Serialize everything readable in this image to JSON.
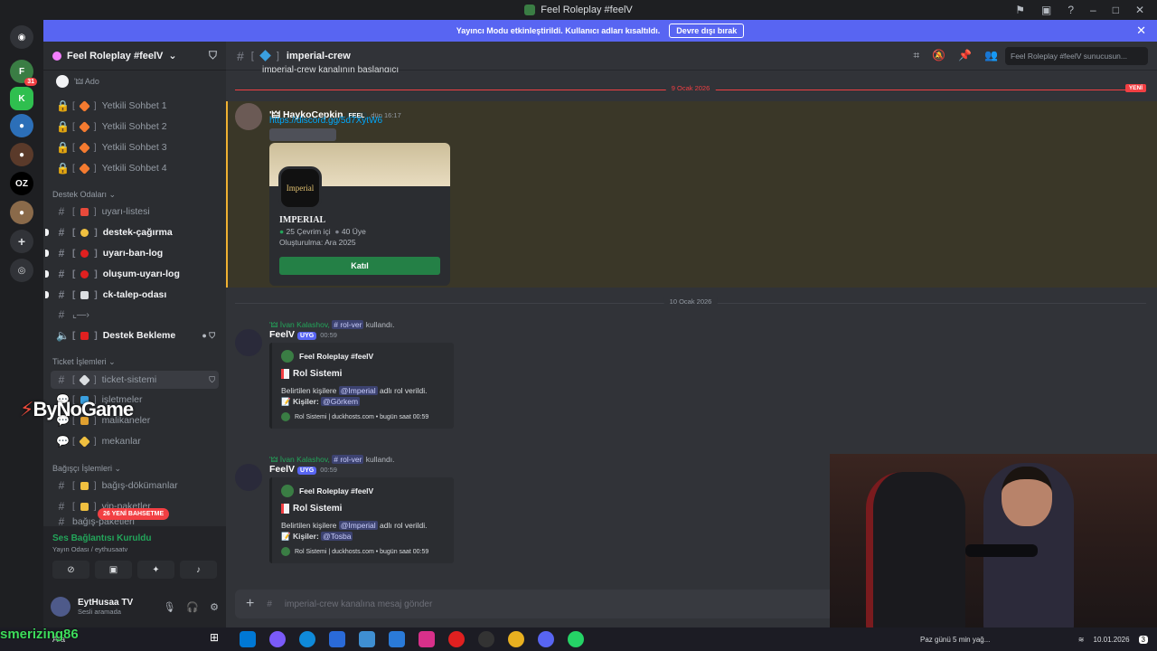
{
  "window": {
    "title": "Feel Roleplay #feelV"
  },
  "banner": {
    "text": "Yayıncı Modu etkinleştirildi. Kullanıcı adları kısaltıldı.",
    "button": "Devre dışı bırak"
  },
  "servers": {
    "dm_badge": "31"
  },
  "guild": {
    "name": "Feel Roleplay #feelV"
  },
  "sidebar": {
    "top_user": "'🜲 Ado",
    "locked_channels": [
      "Yetkili Sohbet 1",
      "Yetkili Sohbet 2",
      "Yetkili Sohbet 3",
      "Yetkili Sohbet 4"
    ],
    "cat_destek": "Destek Odaları ⌄",
    "destek_channels": [
      "uyarı-listesi",
      "destek-çağırma",
      "uyarı-ban-log",
      "oluşum-uyarı-log",
      "ck-talep-odası",
      "⌞—›"
    ],
    "voice_channel": "Destek Bekleme",
    "cat_ticket": "Ticket İşlemleri ⌄",
    "ticket_channels": [
      "ticket-sistemi",
      "işletmeler",
      "malikaneler",
      "mekanlar"
    ],
    "cat_bagis": "Bağışçı İşlemleri ⌄",
    "bagis_channels": [
      "bağış-dökümanlar",
      "vip-paketler",
      "bağış-paketleri"
    ],
    "new_mentions": "26 YENİ BAHSETME"
  },
  "voice": {
    "status": "Ses Bağlantısı Kuruldu",
    "detail": "Yayın Odası / eythusaatv"
  },
  "user": {
    "name": "EytHusaa TV",
    "status": "Sesli aramada"
  },
  "channel": {
    "name": "imperial-crew",
    "search_placeholder": "Feel Roleplay #feelV sunucusun..."
  },
  "top_cut_text": "imperial-crew kanalının başlangıcı",
  "dividers": {
    "d1": "9 Ocak 2026",
    "d2": "10 Ocak 2026",
    "new": "YENİ"
  },
  "msg1": {
    "author": "'🜲 HaykoCepkin",
    "tag": "FEEL",
    "time": "dün 16:17",
    "link": "https://discord.gg/5d7XytW6",
    "invite": {
      "name": "IMPERIAL",
      "online": "25 Çevrim içi",
      "members": "40 Üye",
      "created": "Oluşturulma: Ara 2025",
      "join": "Katıl",
      "logo": "Imperial"
    }
  },
  "msg2": {
    "reply_user": "'🜲 İvan Kalashov,",
    "reply_cmd": "# rol-ver",
    "reply_tail": "kullandı.",
    "author": "FeelV",
    "tag": "UYG",
    "time": "00:59",
    "embed_author": "Feel Roleplay #feelV",
    "embed_title": "Rol Sistemi",
    "desc_pre": "Belirtilen kişilere",
    "desc_role": "@Imperial",
    "desc_post": "adlı rol verildi.",
    "people_label": "Kişiler:",
    "people": "@Görkem",
    "footer": "Rol Sistemi | duckhosts.com • bugün saat 00:59"
  },
  "msg3": {
    "reply_user": "'🜲 İvan Kalashov,",
    "reply_cmd": "# rol-ver",
    "reply_tail": "kullandı.",
    "author": "FeelV",
    "tag": "UYG",
    "time": "00:59",
    "embed_author": "Feel Roleplay #feelV",
    "embed_title": "Rol Sistemi",
    "desc_pre": "Belirtilen kişilere",
    "desc_role": "@Imperial",
    "desc_post": "adlı rol verildi.",
    "people_label": "Kişiler:",
    "people": "@Tosba",
    "footer": "Rol Sistemi | duckhosts.com • bugün saat 00:59"
  },
  "composer": {
    "placeholder": "imperial-crew kanalına mesaj gönder"
  },
  "overlay": {
    "watermark_a": "By",
    "watermark_b": "NoGame",
    "handle": "smerizing86"
  },
  "taskbar": {
    "weather": "Ara",
    "notice": "Paz günü 5 min yağ...",
    "date": "10.01.2026",
    "badge": "3"
  }
}
